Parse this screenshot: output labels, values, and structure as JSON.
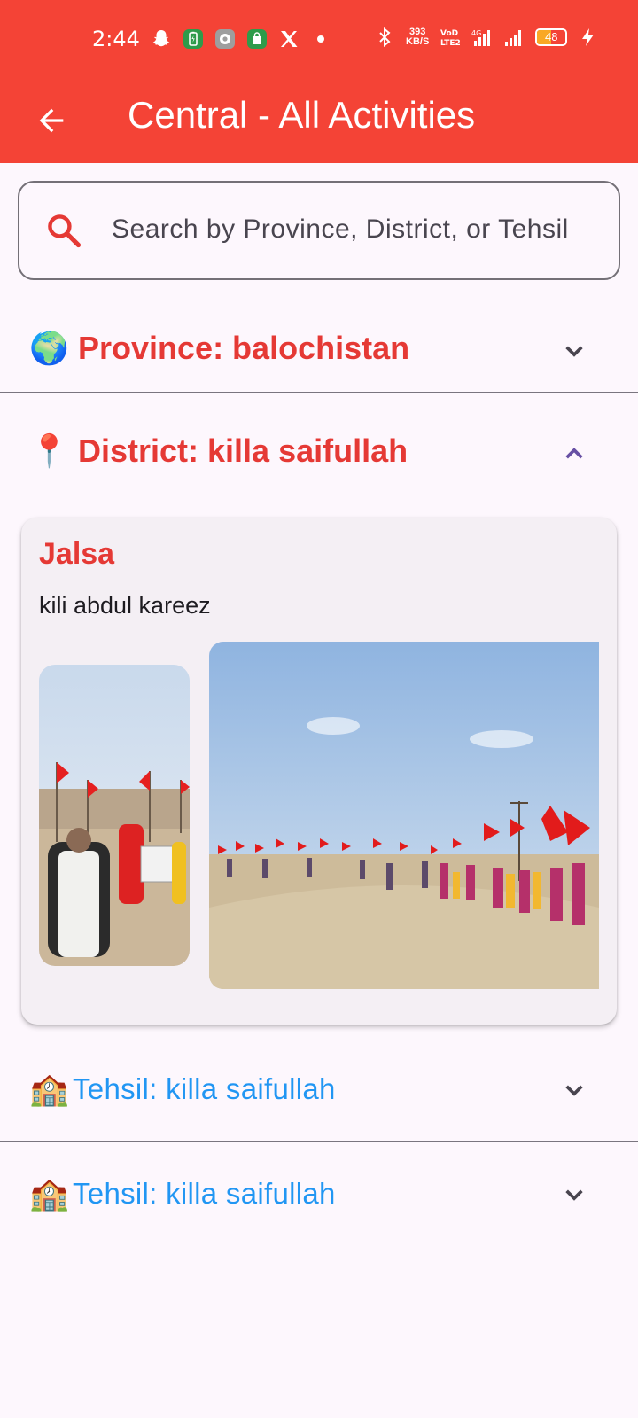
{
  "status_bar": {
    "time": "2:44",
    "net_speed_value": "393",
    "net_speed_unit": "KB/S",
    "volte": "VoLTE2",
    "network": "4G",
    "battery_percent": "48",
    "icons_left": [
      "snapchat-icon",
      "battery-saver-icon",
      "settings-app-icon",
      "store-app-icon",
      "x-app-icon",
      "dot-icon"
    ],
    "icons_right": [
      "bluetooth-icon",
      "signal-4g-icon",
      "signal-icon",
      "battery-icon",
      "charging-icon"
    ]
  },
  "app_bar": {
    "title": "Central - All Activities",
    "back_icon": "arrow-back-icon",
    "color": "#f44336"
  },
  "search": {
    "placeholder": "Search by Province, District, or Tehsil",
    "icon": "search-icon",
    "icon_color": "#e53935"
  },
  "province": {
    "emoji": "🌍",
    "label": "Province: balochistan",
    "expanded": false
  },
  "district": {
    "emoji": "📍",
    "label": "District: killa saifullah",
    "expanded": true
  },
  "activity": {
    "title": "Jalsa",
    "location": "kili abdul kareez",
    "photos": [
      "rally-photo-marchers",
      "rally-photo-road-flags"
    ]
  },
  "tehsils": [
    {
      "emoji": "🏫",
      "label": "Tehsil: killa saifullah",
      "expanded": false
    },
    {
      "emoji": "🏫",
      "label": "Tehsil: killa saifullah",
      "expanded": false
    }
  ],
  "colors": {
    "accent_red": "#e53935",
    "tehsil_blue": "#2196f3",
    "background": "#fdf7fd"
  }
}
